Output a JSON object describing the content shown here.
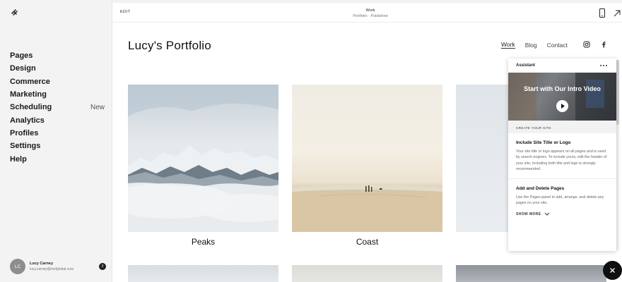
{
  "sidebar": {
    "items": [
      {
        "label": "Pages",
        "badge": ""
      },
      {
        "label": "Design",
        "badge": ""
      },
      {
        "label": "Commerce",
        "badge": ""
      },
      {
        "label": "Marketing",
        "badge": ""
      },
      {
        "label": "Scheduling",
        "badge": "New"
      },
      {
        "label": "Analytics",
        "badge": ""
      },
      {
        "label": "Profiles",
        "badge": ""
      },
      {
        "label": "Settings",
        "badge": ""
      },
      {
        "label": "Help",
        "badge": ""
      }
    ],
    "user": {
      "initials": "LC",
      "name": "Lucy Carney",
      "email": "lucy.carney@mvfglobal.com",
      "notifications": "3"
    }
  },
  "topbar": {
    "edit_label": "EDIT",
    "page_name": "Work",
    "page_status": "Portfolio · Published"
  },
  "site": {
    "title": "Lucy's Portfolio",
    "nav": [
      "Work",
      "Blog",
      "Contact"
    ],
    "active_nav": "Work",
    "social_icons": [
      "instagram-icon",
      "facebook-icon"
    ],
    "gallery": [
      {
        "caption": "Peaks"
      },
      {
        "caption": "Coast"
      }
    ]
  },
  "assistant": {
    "title": "Assistant",
    "video_title": "Start with Our Intro Video",
    "section_label": "CREATE YOUR SITE",
    "tasks": [
      {
        "title": "Include Site Title or Logo",
        "body": "Your site title or logo appears on all pages and is used by search engines. To include yours, edit the header of your site. Including both title and logo is strongly recommended."
      },
      {
        "title": "Add and Delete Pages",
        "body": "Use the Pages panel to add, arrange, and delete any pages on your site."
      }
    ],
    "show_more_label": "SHOW MORE"
  },
  "colors": {
    "accent": "#111111",
    "sidebar_bg": "#f3f3f3",
    "fab_bg": "#0f0f0f"
  }
}
